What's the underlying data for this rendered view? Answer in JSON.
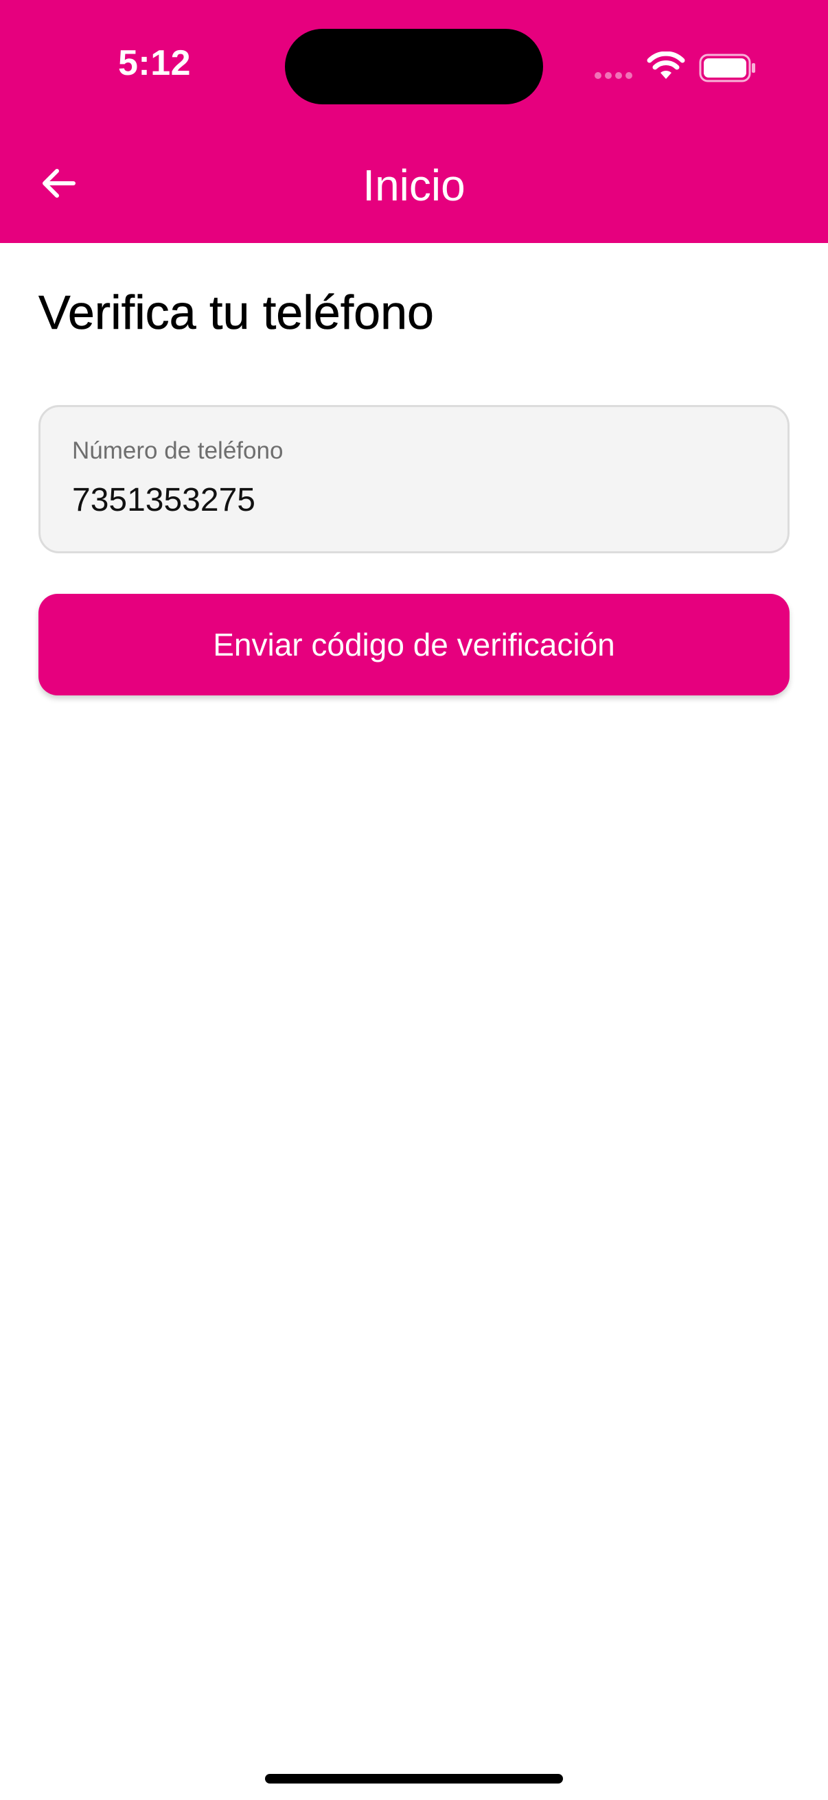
{
  "status_bar": {
    "time": "5:12"
  },
  "nav": {
    "title": "Inicio",
    "back_icon": "arrow-left-icon"
  },
  "main": {
    "heading": "Verifica tu teléfono",
    "phone_field": {
      "label": "Número de teléfono",
      "value": "7351353275"
    },
    "send_button_label": "Enviar código de verificación"
  },
  "colors": {
    "brand": "#E6007E",
    "field_bg": "#F4F4F4",
    "text": "#000000"
  }
}
